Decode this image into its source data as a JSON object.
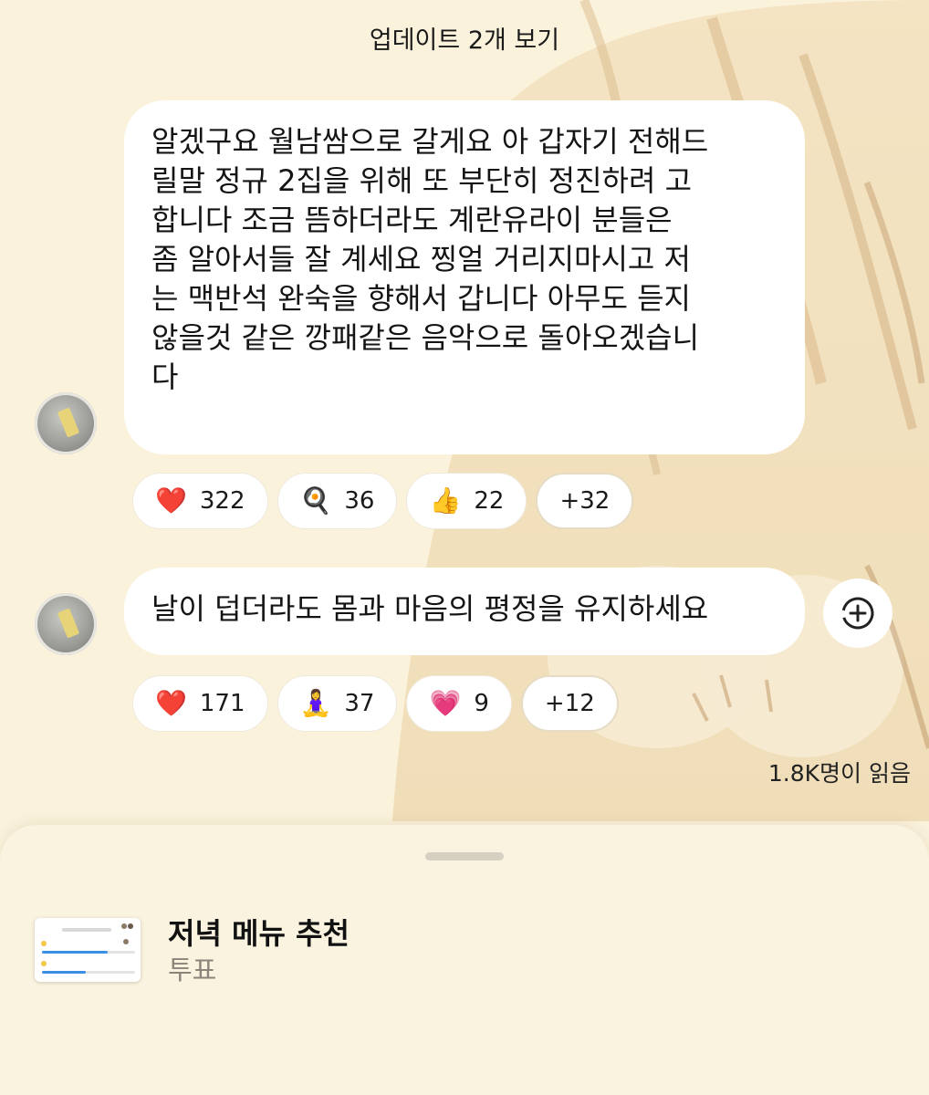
{
  "header": {
    "updates_label": "업데이트 2개 보기"
  },
  "messages": [
    {
      "lines": [
        "알겠구요 월남쌈으로 갈게요 아 갑자기 전해드",
        "릴말 정규 2집을 위해 또 부단히 정진하려 고",
        "합니다  조금 뜸하더라도 계란유라이 분들은",
        "좀 알아서들 잘 계세요 찡얼 거리지마시고 저",
        "는 맥반석 완숙을 향해서 갑니다 아무도 듣지",
        "않을것 같은 깡패같은 음악으로 돌아오겠습니",
        "다"
      ],
      "reactions": [
        {
          "emoji": "❤️",
          "icon": "red-heart",
          "count": "322"
        },
        {
          "emoji": "🍳",
          "icon": "frying-pan-egg",
          "count": "36"
        },
        {
          "emoji": "👍",
          "icon": "thumbs-up",
          "count": "22"
        }
      ],
      "more": "+32"
    },
    {
      "lines": [
        "날이 덥더라도 몸과 마음의 평정을 유지하세요"
      ],
      "reactions": [
        {
          "emoji": "❤️",
          "icon": "red-heart",
          "count": "171"
        },
        {
          "emoji": "🧘‍♀️",
          "icon": "person-in-lotus-position",
          "count": "37"
        },
        {
          "emoji": "💗",
          "icon": "growing-heart",
          "count": "9"
        }
      ],
      "more": "+12"
    }
  ],
  "read_count": "1.8K명이 읽음",
  "sheet": {
    "title": "저녁 메뉴 추천",
    "subtitle": "투표"
  },
  "colors": {
    "background": "#fbf2dc",
    "bubble": "#ffffff",
    "poll_bar": "#3b8ee6",
    "subtitle": "#8a847a"
  }
}
